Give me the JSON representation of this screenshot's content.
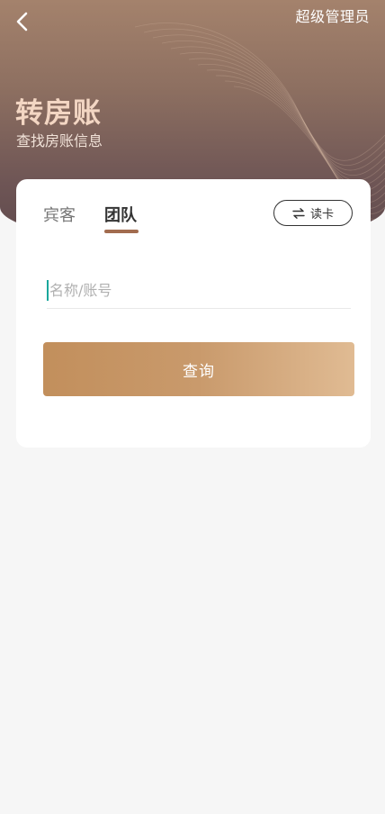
{
  "header": {
    "role": "超级管理员",
    "title": "转房账",
    "subtitle": "查找房账信息"
  },
  "tabs": [
    {
      "label": "宾客",
      "active": false
    },
    {
      "label": "团队",
      "active": true
    }
  ],
  "read_card": {
    "label": "读卡",
    "icon": "swap-arrows-icon"
  },
  "search": {
    "placeholder": "名称/账号",
    "value": ""
  },
  "query_button": {
    "label": "查询"
  },
  "colors": {
    "accent": "#a26c4f",
    "button_start": "#c28f5c",
    "button_end": "#e0bb93",
    "caret": "#1aa79c"
  }
}
